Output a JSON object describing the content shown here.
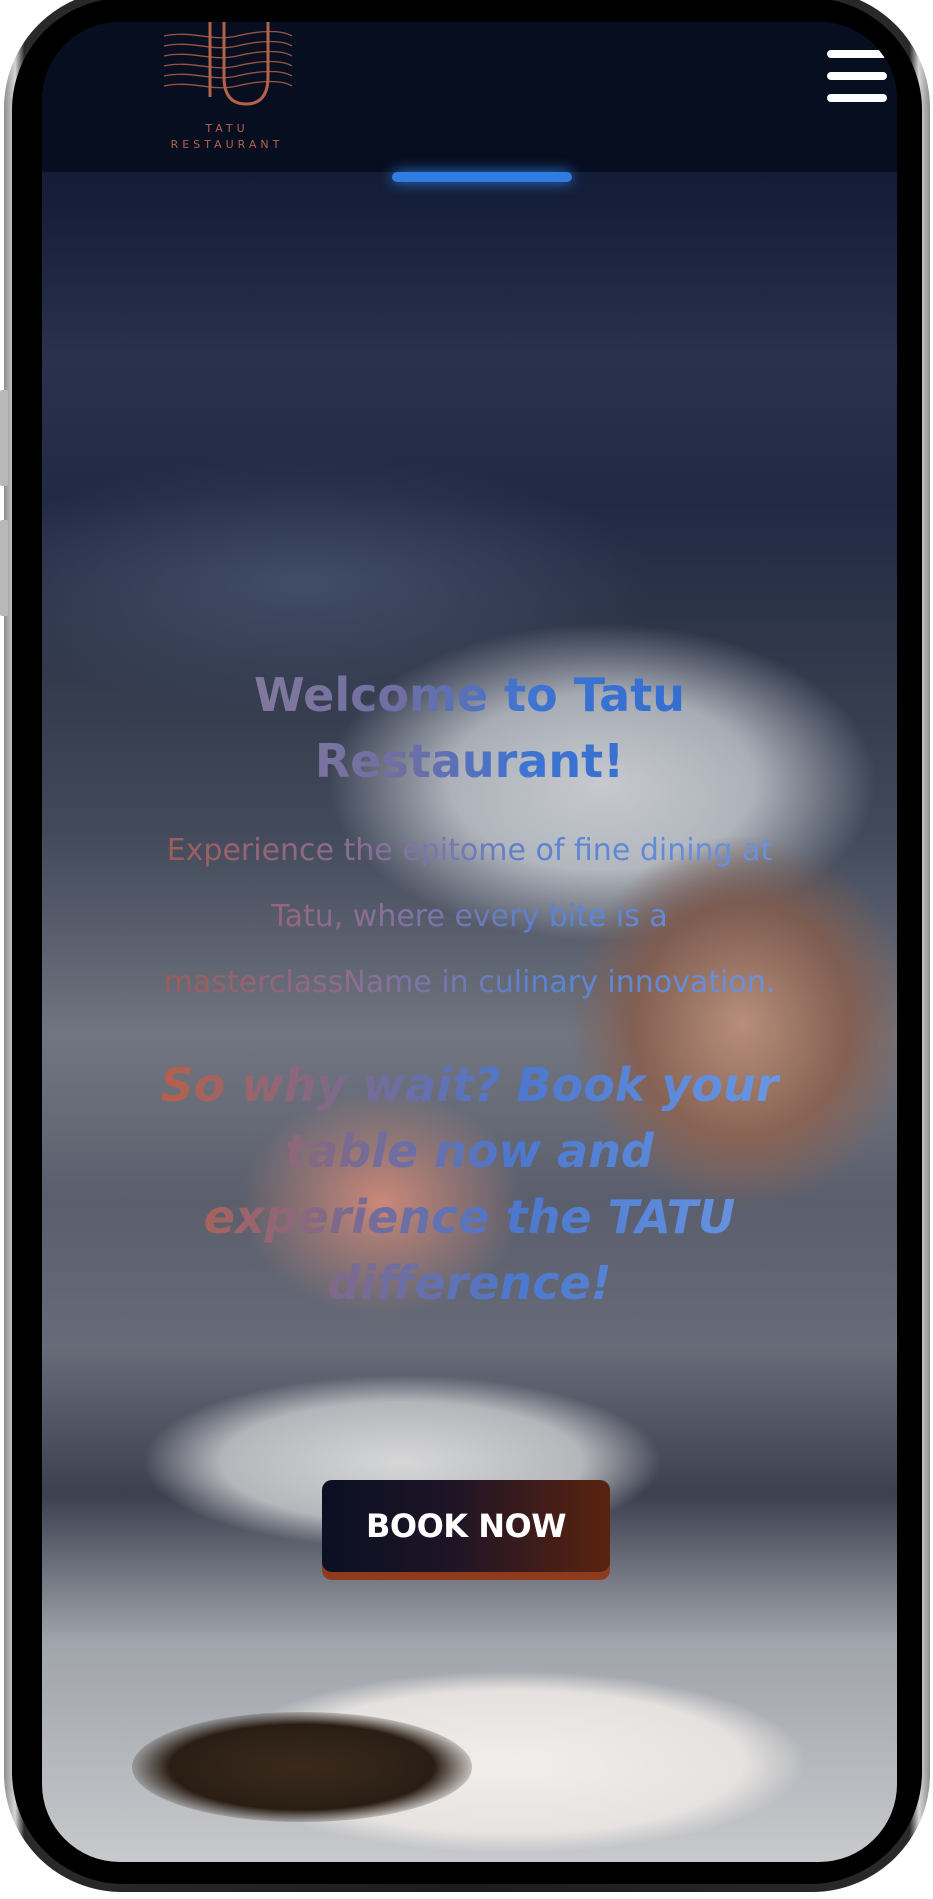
{
  "brand": {
    "logo_mark": "TU",
    "logo_line1": "TATU",
    "logo_line2": "RESTAURANT"
  },
  "nav": {
    "menu_icon": "hamburger-menu-icon"
  },
  "hero": {
    "title": "Welcome to Tatu Restaurant!",
    "description": "Experience the epitome of fine dining at Tatu, where every bite is a masterclassName in culinary innovation.",
    "call_to_action": "So why wait? Book your table now and experience the TATU difference!",
    "book_button_label": "BOOK NOW"
  },
  "colors": {
    "header_bg": "#070e20",
    "logo_accent": "#b5624a",
    "title_blue": "#2f6bcf",
    "button_dark": "#0a1022",
    "button_rust": "#8e3a1c"
  }
}
